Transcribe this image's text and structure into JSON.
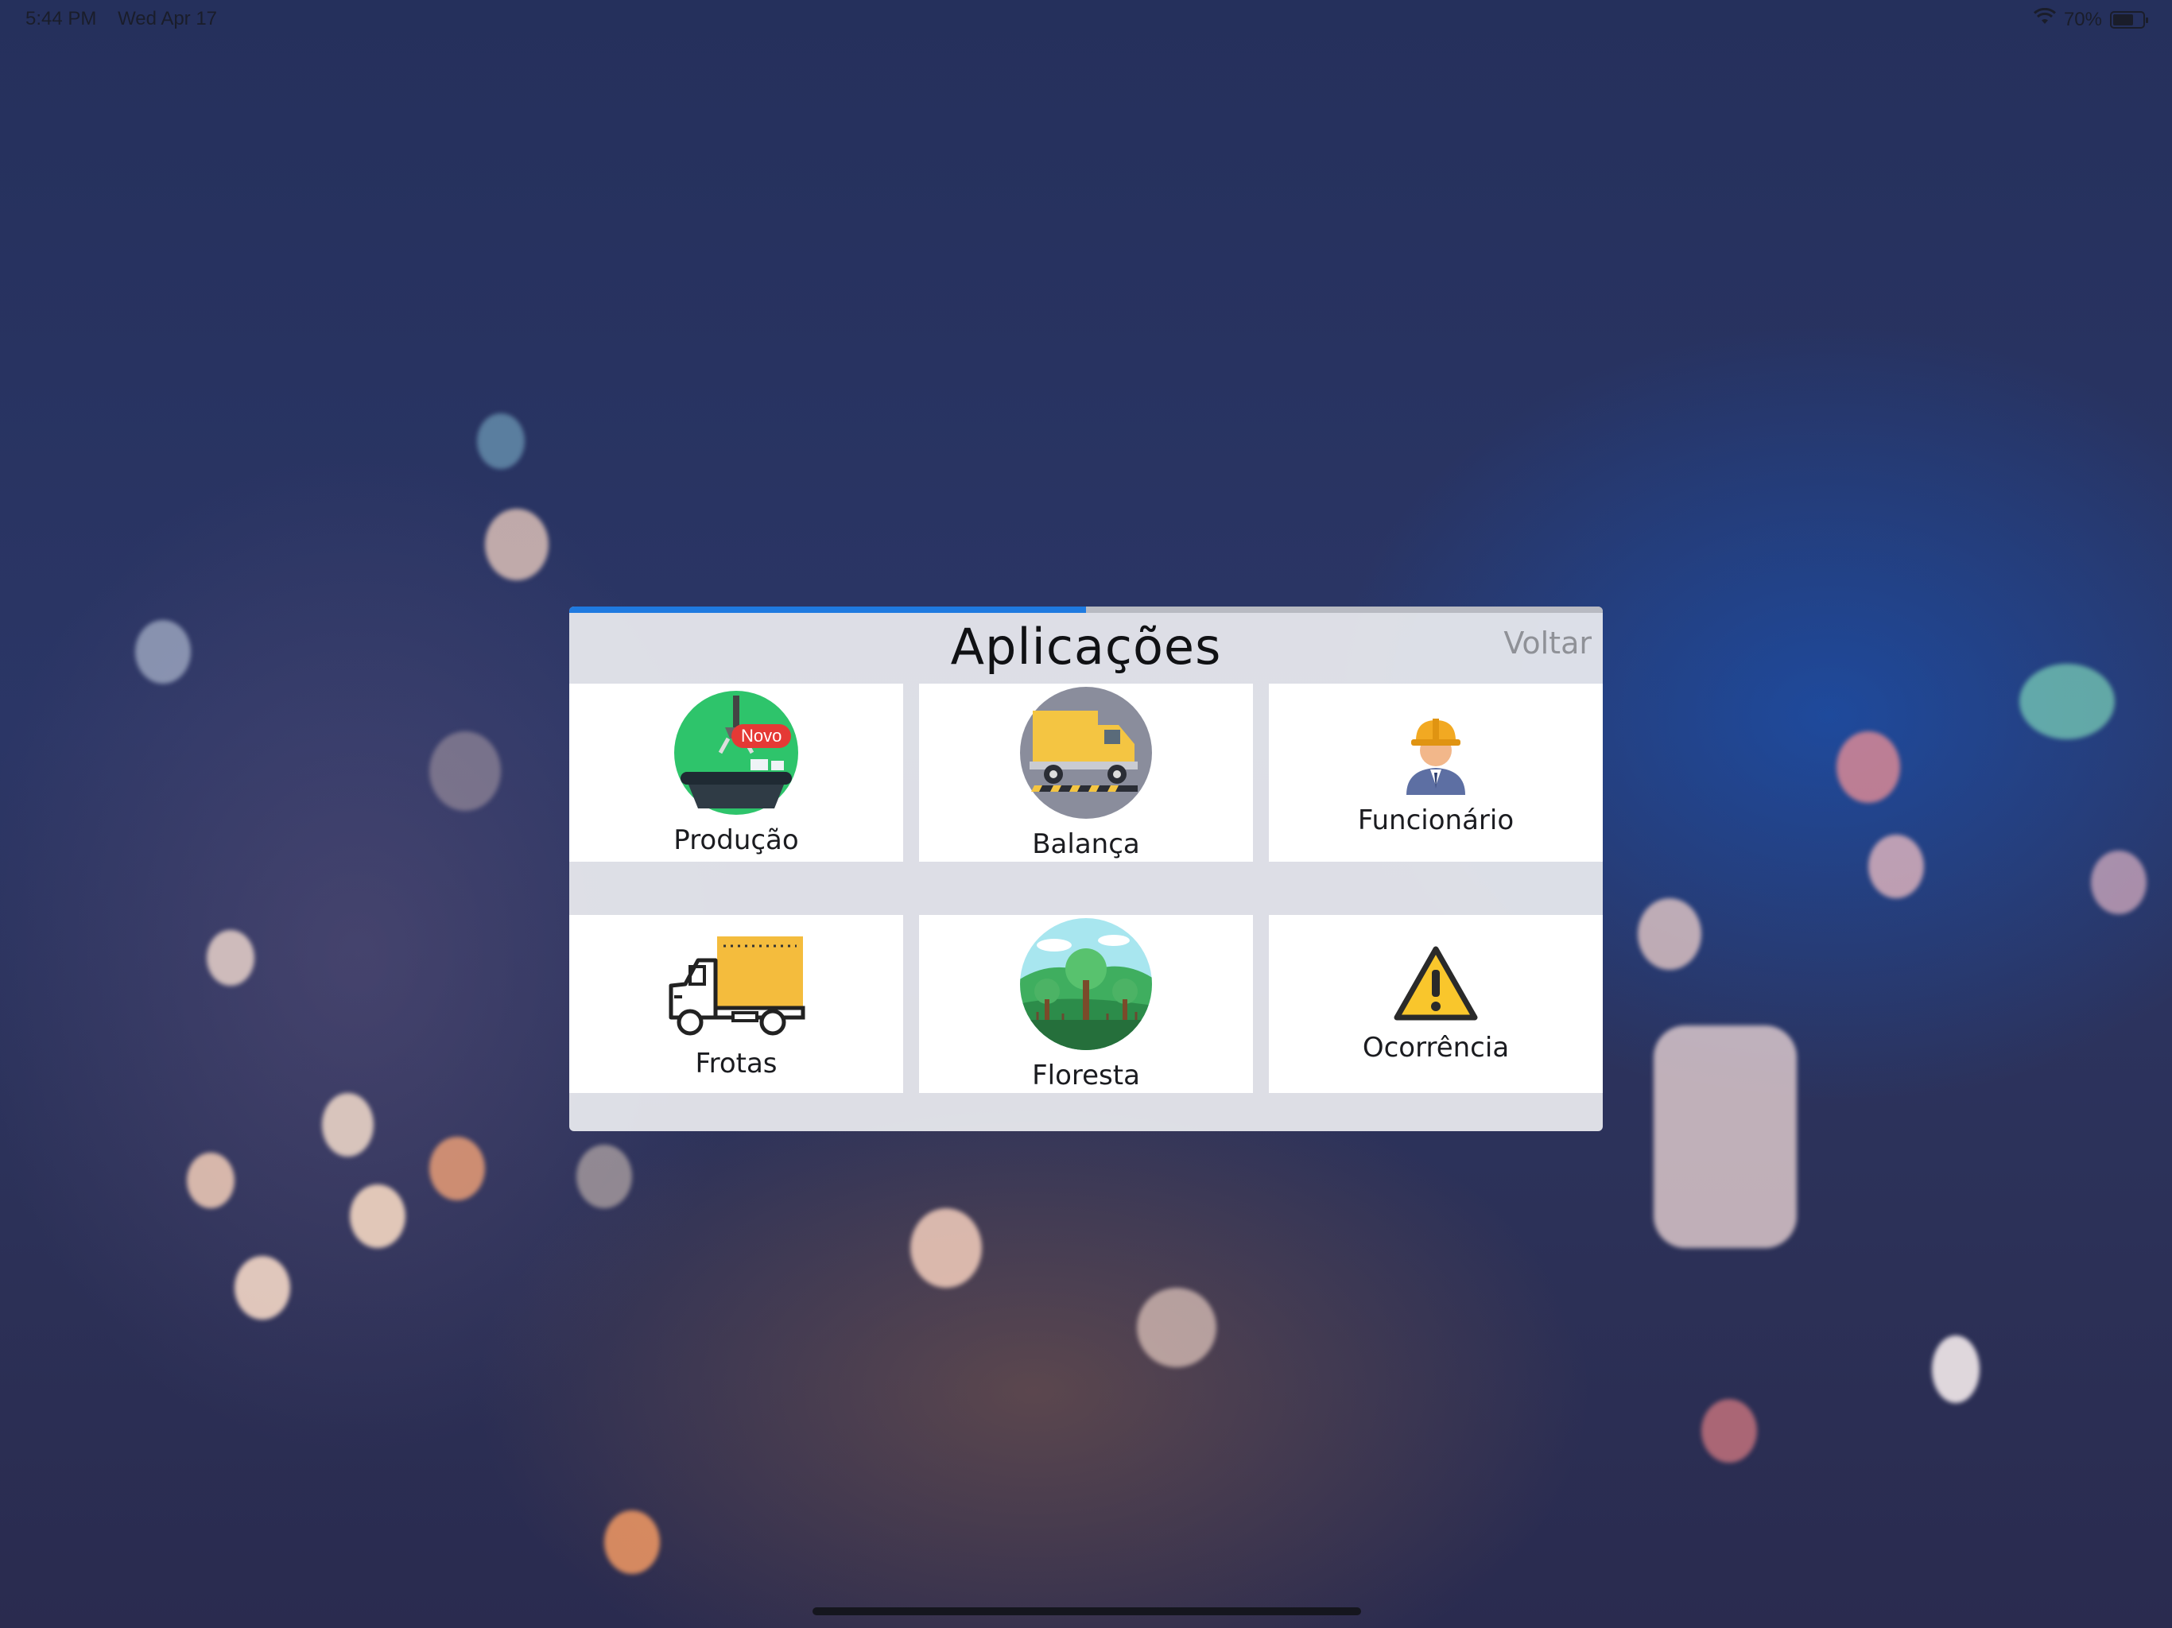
{
  "status_bar": {
    "time": "5:44 PM",
    "date": "Wed Apr 17",
    "battery": "70%",
    "battery_level": 0.7,
    "wifi_icon": "wifi-icon"
  },
  "header": {
    "title": "Aplicações",
    "back_label": "Voltar",
    "progress": 0.5,
    "progress_color": "#1f7ae0"
  },
  "apps": [
    {
      "label": "Produção",
      "icon": "production-icon",
      "badge": "Novo"
    },
    {
      "label": "Balança",
      "icon": "scale-truck-icon"
    },
    {
      "label": "Funcionário",
      "icon": "worker-icon"
    },
    {
      "label": "Frotas",
      "icon": "fleet-truck-icon"
    },
    {
      "label": "Floresta",
      "icon": "forest-icon"
    },
    {
      "label": "Ocorrência",
      "icon": "warning-icon"
    }
  ]
}
